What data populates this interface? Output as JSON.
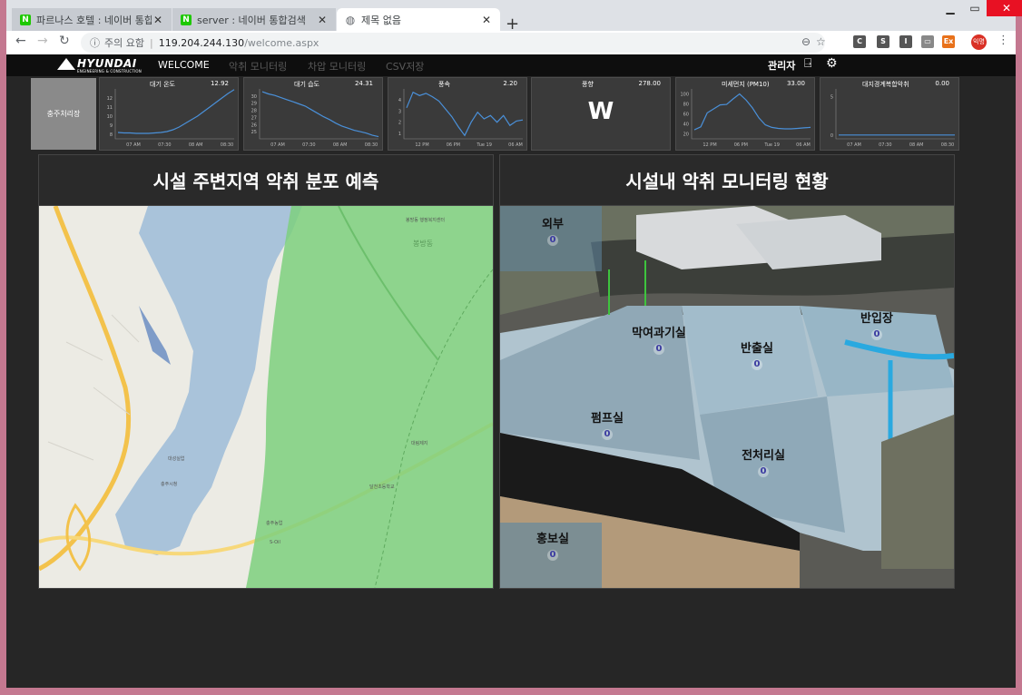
{
  "browser": {
    "tabs": [
      {
        "title": "파르나스 호텔 : 네이버 통합검색",
        "favicon": "naver-icon",
        "active": false
      },
      {
        "title": "server : 네이버 통합검색",
        "favicon": "naver-icon",
        "active": false
      },
      {
        "title": "제목 없음",
        "favicon": "globe-icon",
        "active": true
      }
    ],
    "security_label": "주의 요함",
    "url_host": "119.204.244.130",
    "url_path": "/welcome.aspx",
    "extensions": [
      "C",
      "S",
      "I",
      "▭",
      "Ex"
    ],
    "profile_label": "익명"
  },
  "app": {
    "logo_name": "HYUNDAI",
    "logo_sub": "ENGINEERING & CONSTRUCTION",
    "nav": [
      {
        "label": "WELCOME",
        "active": true
      },
      {
        "label": "악취 모니터링",
        "active": false
      },
      {
        "label": "차압 모니터링",
        "active": false
      },
      {
        "label": "CSV저장",
        "active": false
      }
    ],
    "admin_label": "관리자"
  },
  "station_button": "충주처리장",
  "cards": [
    {
      "title": "대기 온도",
      "value": "12.92",
      "y_ticks": [
        "12",
        "11",
        "10",
        "9",
        "8"
      ],
      "x_ticks": [
        "07 AM",
        "07:30",
        "08 AM",
        "08:30"
      ],
      "ylim": [
        7.5,
        13
      ],
      "series": [
        8.2,
        8.15,
        8.15,
        8.1,
        8.1,
        8.1,
        8.15,
        8.2,
        8.3,
        8.5,
        8.8,
        9.2,
        9.6,
        10.0,
        10.5,
        11.0,
        11.5,
        12.0,
        12.5,
        12.92
      ]
    },
    {
      "title": "대기 습도",
      "value": "24.31",
      "y_ticks": [
        "30",
        "29",
        "28",
        "27",
        "26",
        "25"
      ],
      "x_ticks": [
        "07 AM",
        "07:30",
        "08 AM",
        "08:30"
      ],
      "ylim": [
        24,
        31
      ],
      "series": [
        30.6,
        30.3,
        30.1,
        29.8,
        29.5,
        29.2,
        28.9,
        28.6,
        28.1,
        27.6,
        27.1,
        26.7,
        26.2,
        25.8,
        25.5,
        25.2,
        25.0,
        24.8,
        24.5,
        24.31
      ]
    },
    {
      "title": "풍속",
      "value": "2.20",
      "y_ticks": [
        "4",
        "3",
        "2",
        "1"
      ],
      "x_ticks": [
        "12 PM",
        "06 PM",
        "Tue 19",
        "06 AM"
      ],
      "ylim": [
        0.5,
        5
      ],
      "series": [
        3.3,
        4.7,
        4.4,
        4.6,
        4.3,
        3.9,
        3.2,
        2.5,
        1.6,
        0.8,
        2.0,
        2.9,
        2.3,
        2.6,
        2.0,
        2.6,
        1.7,
        2.1,
        2.2
      ]
    },
    {
      "title": "풍향",
      "value": "278.00",
      "display": "W"
    },
    {
      "title": "미세먼지 (PM10)",
      "value": "33.00",
      "y_ticks": [
        "100",
        "80",
        "60",
        "40",
        "20"
      ],
      "x_ticks": [
        "12 PM",
        "06 PM",
        "Tue 19",
        "06 AM"
      ],
      "ylim": [
        10,
        110
      ],
      "series": [
        28,
        34,
        62,
        70,
        78,
        79,
        90,
        100,
        88,
        72,
        52,
        38,
        33,
        31,
        30,
        30,
        31,
        32,
        33
      ]
    },
    {
      "title": "대지경계복합악취",
      "value": "0.00",
      "y_ticks": [
        "5",
        "0"
      ],
      "x_ticks": [
        "07 AM",
        "07:30",
        "08 AM",
        "08:30"
      ],
      "ylim": [
        -0.5,
        6
      ],
      "series": [
        0,
        0,
        0,
        0,
        0,
        0,
        0,
        0,
        0,
        0,
        0,
        0,
        0,
        0,
        0,
        0,
        0,
        0,
        0,
        0
      ]
    }
  ],
  "panels": {
    "left_title": "시설 주변지역 악취 분포 예측",
    "right_title": "시설내 악취 모니터링 현황"
  },
  "map_labels": [
    "봉방동",
    "대성실업",
    "충주시청",
    "충주농업",
    "달천초등학교",
    "봉방동 행정복지센터",
    "S-Oil",
    "대림제지"
  ],
  "rooms": [
    {
      "name": "외부",
      "value": "0"
    },
    {
      "name": "막여과기실",
      "value": "0"
    },
    {
      "name": "반출실",
      "value": "0"
    },
    {
      "name": "반입장",
      "value": "0"
    },
    {
      "name": "펌프실",
      "value": "0"
    },
    {
      "name": "전처리실",
      "value": "0"
    },
    {
      "name": "홍보실",
      "value": "0"
    }
  ],
  "colors": {
    "chart_line": "#4a90d9",
    "nav_active": "#ffffff",
    "nav_inactive": "#5a5a5a",
    "map_plume": "#7ed07e"
  }
}
